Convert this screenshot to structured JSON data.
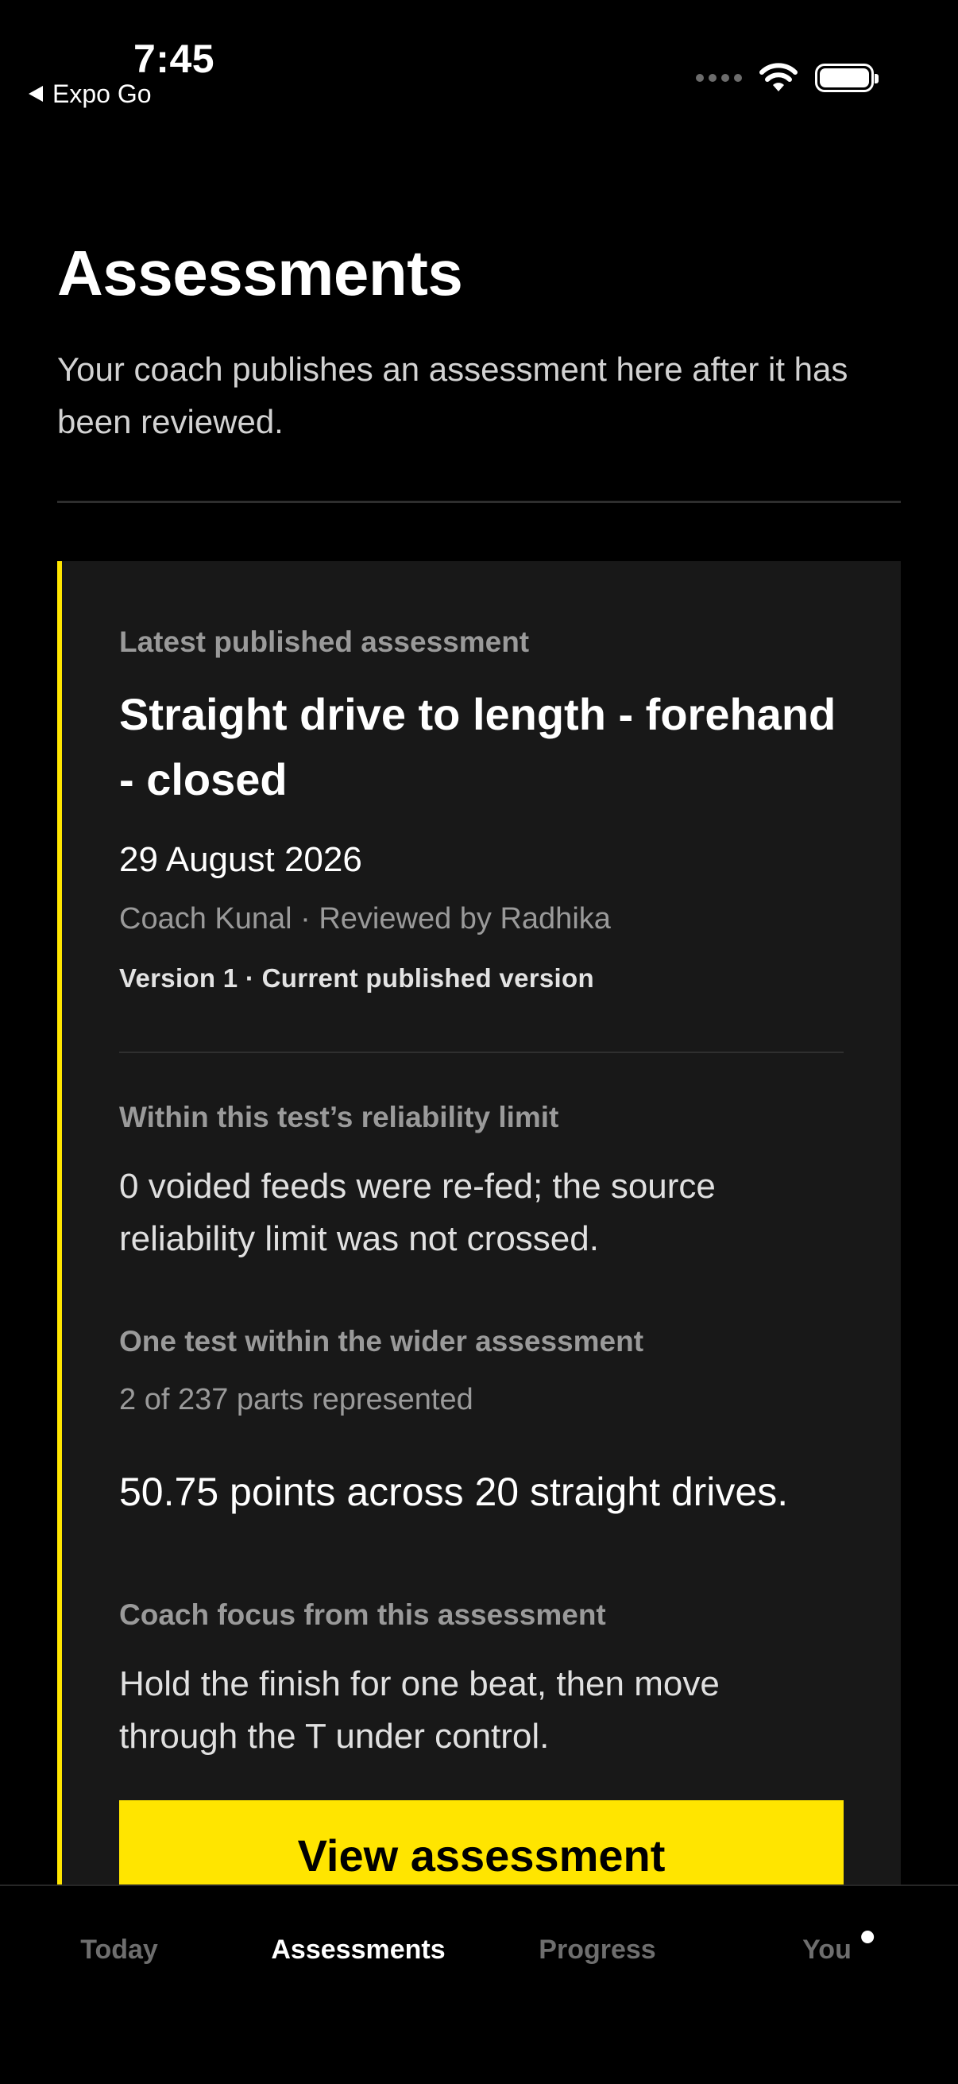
{
  "status_bar": {
    "time": "7:45",
    "back_label": "Expo Go"
  },
  "header": {
    "title": "Assessments",
    "subtitle": "Your coach publishes an assessment here after it has been reviewed."
  },
  "card": {
    "accent_color": "#ffe500",
    "eyebrow": "Latest published assessment",
    "title": "Straight drive to length - forehand - closed",
    "date": "29 August 2026",
    "coach_line": "Coach Kunal · Reviewed by Radhika",
    "version_line": "Version 1 · Current published version",
    "reliability": {
      "heading": "Within this test’s reliability limit",
      "text": "0 voided feeds were re-fed; the source reliability limit was not crossed."
    },
    "scope": {
      "heading": "One test within the wider assessment",
      "text": "2 of 237 parts represented"
    },
    "score_text": "50.75 points across 20 straight drives.",
    "focus": {
      "heading": "Coach focus from this assessment",
      "text": "Hold the finish for one beat, then move through the T under control."
    },
    "button_label": "View assessment"
  },
  "tab_bar": {
    "tabs": [
      {
        "label": "Today",
        "active": false
      },
      {
        "label": "Assessments",
        "active": true
      },
      {
        "label": "Progress",
        "active": false
      },
      {
        "label": "You",
        "active": false,
        "has_dot": true
      }
    ]
  }
}
